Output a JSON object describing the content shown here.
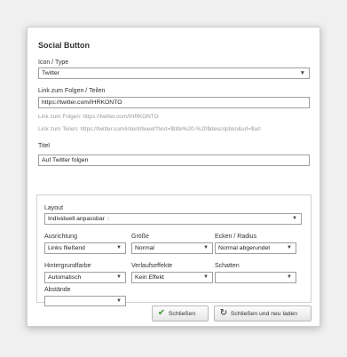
{
  "dialog": {
    "title": "Social Button"
  },
  "icon_type": {
    "label": "Icon / Type",
    "value": "Twitter"
  },
  "link": {
    "label": "Link zum Folgen / Teilen",
    "value": "https://twitter.com/IHRKONTO",
    "hint_follow": "Link zum Folgen: https://twitter.com/IHRKONTO",
    "hint_share": "Link zum Teilen: https://twitter.com/intent/tweet?text=$title%20-%20$description&url=$url"
  },
  "title_field": {
    "label": "Titel",
    "value": "Auf Twitter folgen"
  },
  "layout": {
    "label": "Layout",
    "value": "Individuell anpassbar",
    "lock_icon": "lock-icon"
  },
  "ausrichtung": {
    "label": "Ausrichtung",
    "value": "Links fließend"
  },
  "groesse": {
    "label": "Größe",
    "value": "Normal"
  },
  "ecken": {
    "label": "Ecken / Radius",
    "value": "Normal abgerundet"
  },
  "hintergrund": {
    "label": "Hintergrundfarbe",
    "value": "Automatisch"
  },
  "verlauf": {
    "label": "Verlaufseffekte",
    "value": "Kein Effekt"
  },
  "schatten": {
    "label": "Schatten",
    "value": ""
  },
  "abstaende": {
    "label": "Abstände",
    "value": ""
  },
  "buttons": {
    "close": "Schließen",
    "close_reload": "Schließen und neu laden",
    "close_icon": "check-icon",
    "close_reload_icon": "refresh-icon"
  },
  "colors": {
    "check": "#3b9a2e",
    "border": "#9f9f9f"
  }
}
